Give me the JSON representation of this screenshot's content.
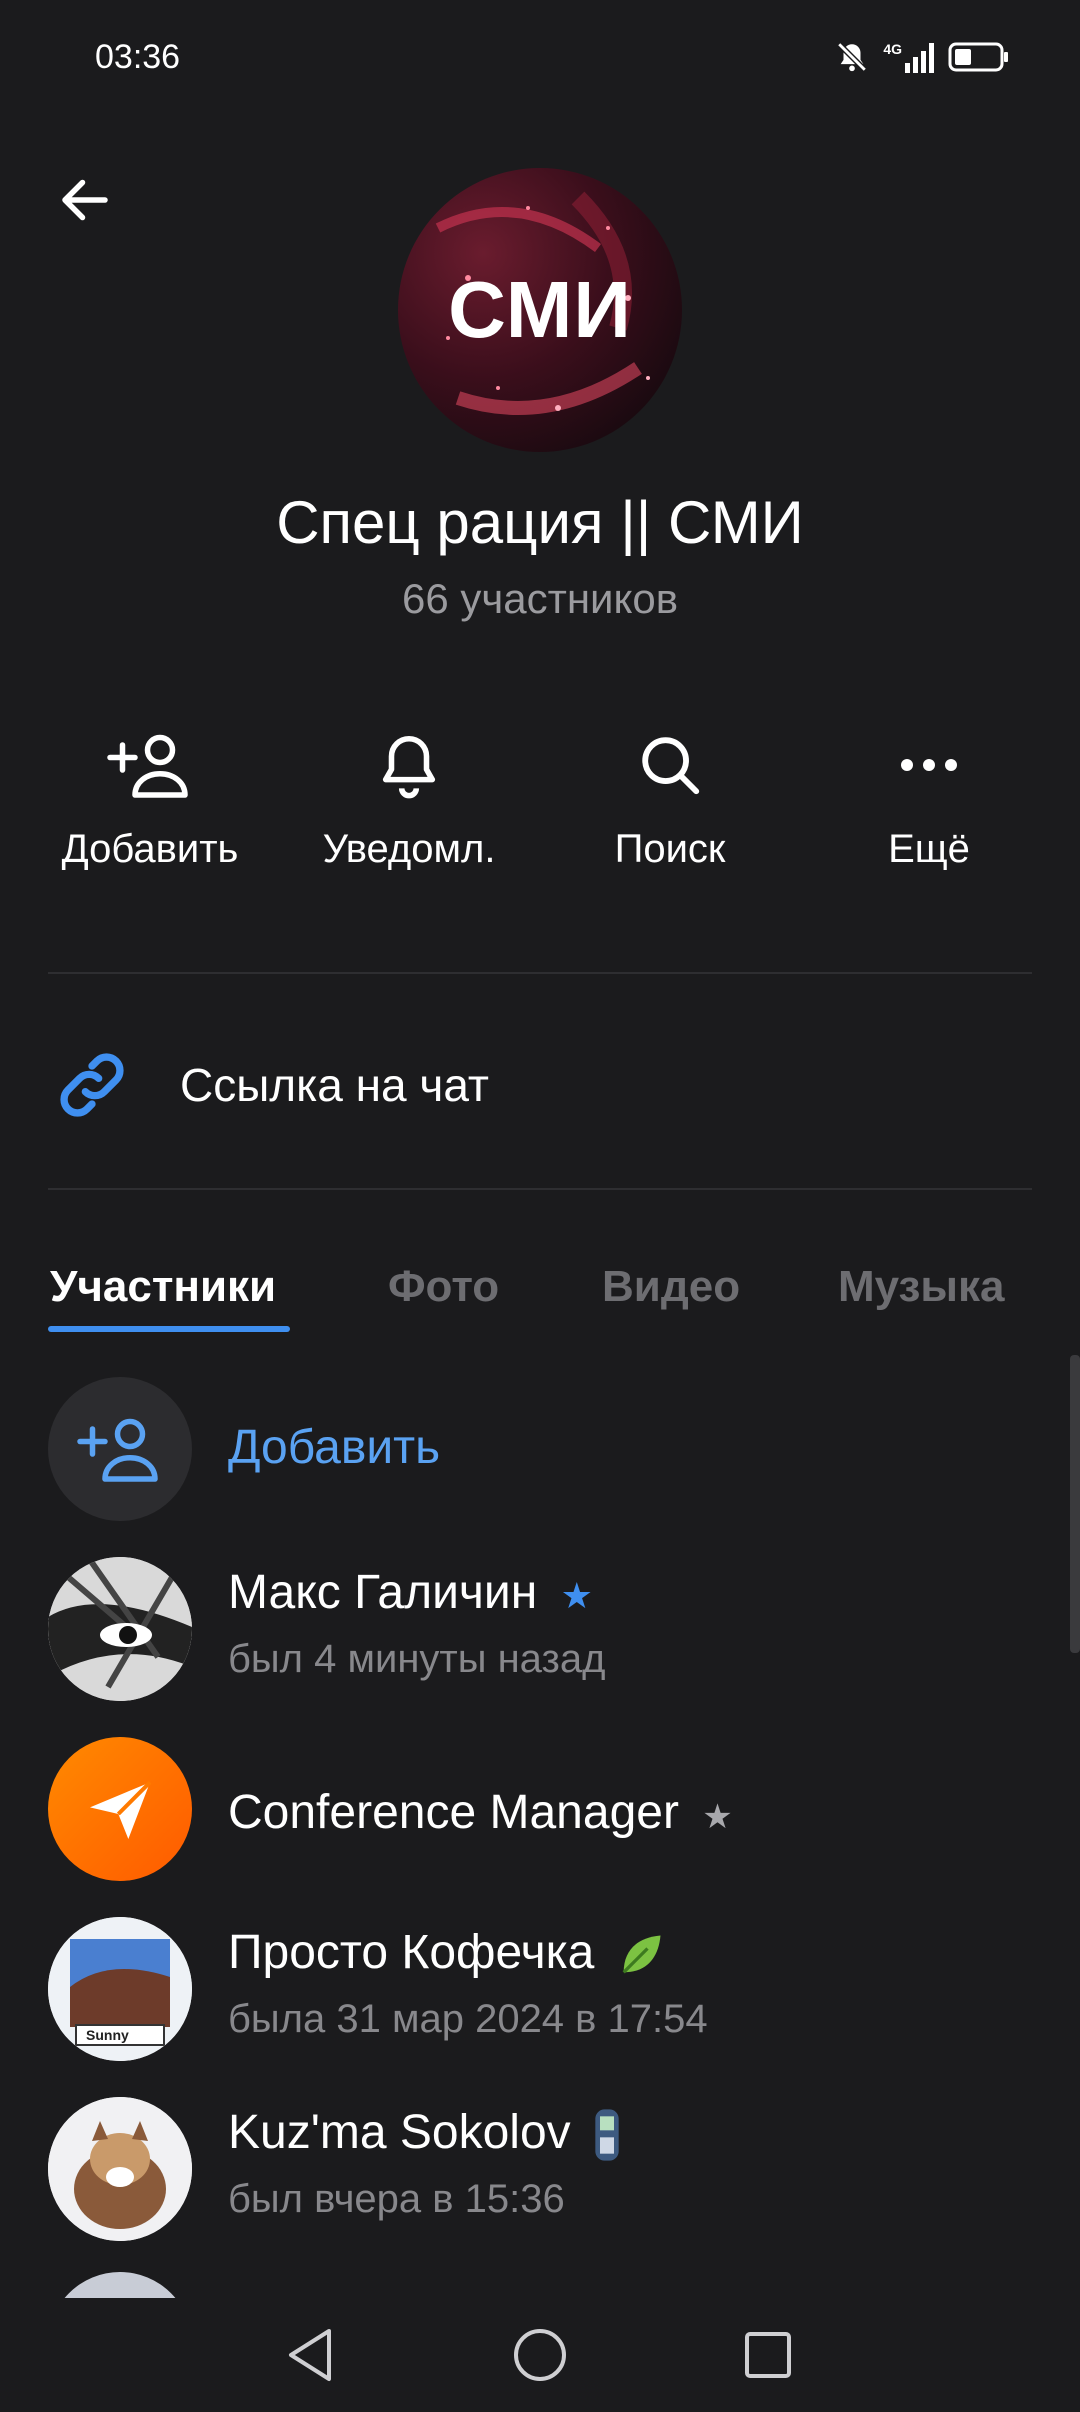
{
  "status_bar": {
    "time": "03:36",
    "network": "4G"
  },
  "header": {
    "avatar_text": "СМИ",
    "title": "Спец рация || СМИ",
    "subtitle": "66 участников"
  },
  "actions": [
    {
      "label": "Добавить",
      "icon": "add-user-icon"
    },
    {
      "label": "Уведомл.",
      "icon": "bell-icon"
    },
    {
      "label": "Поиск",
      "icon": "search-icon"
    },
    {
      "label": "Ещё",
      "icon": "more-icon"
    }
  ],
  "chat_link": {
    "label": "Ссылка на чат",
    "icon": "link-icon"
  },
  "tabs": [
    {
      "label": "Участники",
      "active": true
    },
    {
      "label": "Фото",
      "active": false
    },
    {
      "label": "Видео",
      "active": false
    },
    {
      "label": "Музыка",
      "active": false
    }
  ],
  "members": {
    "add_label": "Добавить",
    "list": [
      {
        "name": "Макс Галичин",
        "status": "был 4 минуты назад",
        "badge": "star-blue"
      },
      {
        "name": "Conference Manager",
        "status": "",
        "badge": "star-gray"
      },
      {
        "name": "Просто Кофечка",
        "status": "была 31 мар 2024 в 17:54",
        "badge": "leaf-emoji",
        "avatar_caption": "Sunny"
      },
      {
        "name": "Kuz'ma Sokolov",
        "status": "был вчера в 15:36",
        "badge": "phone-emoji"
      }
    ]
  },
  "colors": {
    "background": "#1b1b1d",
    "accent": "#3f8ff0",
    "link": "#5aa2f2",
    "muted": "#88888c"
  }
}
